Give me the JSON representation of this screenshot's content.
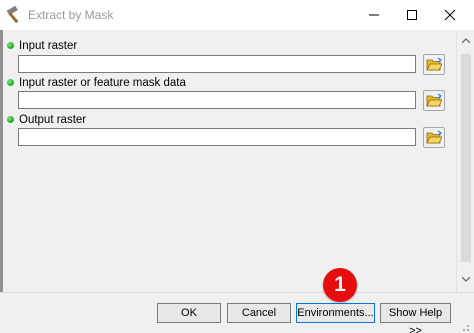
{
  "window": {
    "title": "Extract by Mask",
    "title_icon": "hammer-icon",
    "controls": [
      "minimize-icon",
      "maximize-icon",
      "close-icon"
    ]
  },
  "parameters": [
    {
      "label": "Input raster",
      "value": "",
      "required": true,
      "browse_icon": "folder-open-icon"
    },
    {
      "label": "Input raster or feature mask data",
      "value": "",
      "required": true,
      "browse_icon": "folder-open-icon"
    },
    {
      "label": "Output raster",
      "value": "",
      "required": true,
      "browse_icon": "folder-open-icon"
    }
  ],
  "buttons": {
    "ok": "OK",
    "cancel": "Cancel",
    "environments": "Environments...",
    "show_help": "Show Help >>"
  },
  "annotation": {
    "callout_number": "1",
    "color": "#e60d0d"
  },
  "colors": {
    "required_dot": "#1aa51a",
    "focus_border": "#0078d7"
  }
}
